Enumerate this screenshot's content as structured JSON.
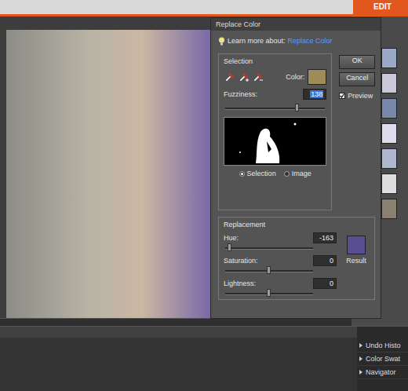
{
  "app": {
    "mode": "EDIT"
  },
  "dialog": {
    "title": "Replace Color",
    "learn_label": "Learn more about:",
    "learn_link": "Replace Color",
    "selection": {
      "legend": "Selection",
      "color_label": "Color:",
      "color": "#9e8c5a",
      "fuzziness_label": "Fuzziness:",
      "fuzziness": "138",
      "fuzziness_level": 0.72,
      "views": [
        {
          "label": "Selection",
          "selected": true
        },
        {
          "label": "Image",
          "selected": false
        }
      ]
    },
    "buttons": [
      "OK",
      "Cancel"
    ],
    "preview": {
      "label": "Preview",
      "checked": true
    },
    "replacement": {
      "legend": "Replacement",
      "sliders": [
        {
          "label": "Hue:",
          "value": "-163",
          "level": 0.05
        },
        {
          "label": "Saturation:",
          "value": "0",
          "level": 0.5
        },
        {
          "label": "Lightness:",
          "value": "0",
          "level": 0.5
        }
      ],
      "result_label": "Result",
      "result_color": "#5a4e92"
    }
  },
  "panels": [
    {
      "label": "Undo Histo"
    },
    {
      "label": "Color Swat"
    },
    {
      "label": "Navigator"
    }
  ]
}
